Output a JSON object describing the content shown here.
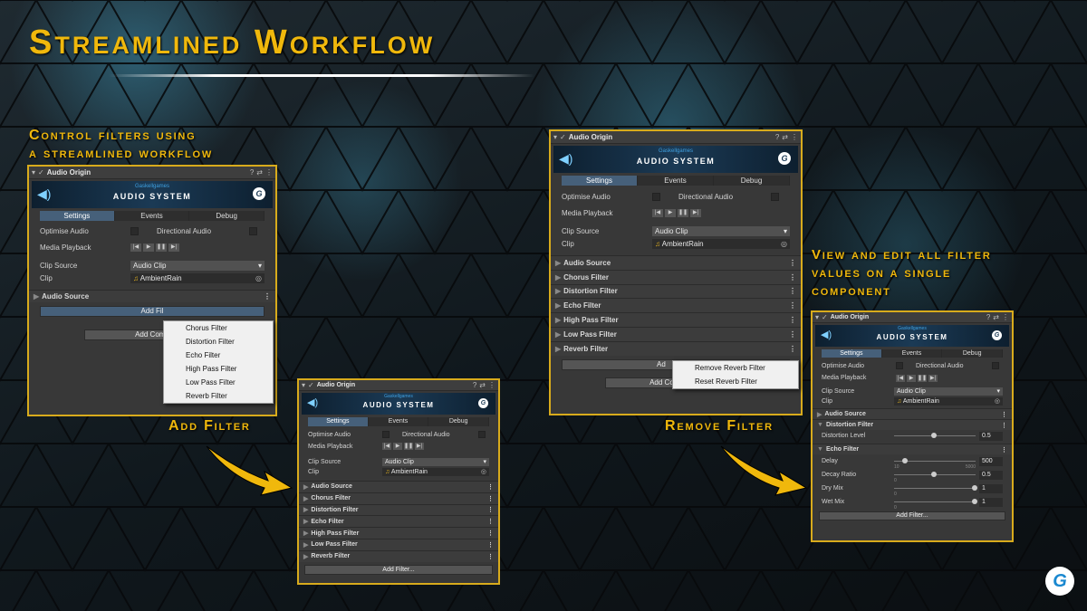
{
  "title": "Streamlined Workflow",
  "captions": {
    "control_l1": "Control filters using",
    "control_l2": "a streamlined workflow",
    "view_l1": "View and edit all filter",
    "view_l2": "values on a single",
    "view_l3": "component",
    "add_filter": "Add Filter",
    "remove_filter": "Remove Filter"
  },
  "component": {
    "name": "Audio Origin",
    "banner_sub": "Gaskellgames",
    "banner_title": "AUDIO SYSTEM",
    "tabs": [
      "Settings",
      "Events",
      "Debug"
    ],
    "optimise": "Optimise Audio",
    "directional": "Directional Audio",
    "media_playback": "Media Playback",
    "clip_source": "Clip Source",
    "clip_source_value": "Audio Clip",
    "clip": "Clip",
    "clip_value": "AmbientRain",
    "add_filter_btn": "Add Filter...",
    "add_component_btn": "Add Component",
    "add_component_trunc": "Add Comp",
    "add_trunc": "Add Fil",
    "add_short": "Ad"
  },
  "sections": [
    "Audio Source",
    "Chorus Filter",
    "Distortion Filter",
    "Echo Filter",
    "High Pass Filter",
    "Low Pass Filter",
    "Reverb Filter"
  ],
  "add_menu": [
    "Chorus Filter",
    "Distortion Filter",
    "Echo Filter",
    "High Pass Filter",
    "Low Pass Filter",
    "Reverb Filter"
  ],
  "remove_menu": [
    "Remove Reverb Filter",
    "Reset Reverb Filter"
  ],
  "detail": {
    "distortion_level": "Distortion Level",
    "distortion_value": "0.5",
    "delay": "Delay",
    "delay_value": "500",
    "delay_min": "10",
    "delay_max": "5000",
    "decay_ratio": "Decay Ratio",
    "decay_value": "0.5",
    "dry_mix": "Dry Mix",
    "dry_value": "1",
    "wet_mix": "Wet Mix",
    "wet_value": "1",
    "zero": "0"
  },
  "colors": {
    "accent": "#f0b80c",
    "border": "#d8ab1c",
    "panel": "#383838",
    "tab_active": "#46607a"
  },
  "icons": {
    "check": "✓",
    "help": "?",
    "preset": "⇄",
    "more": "⋮",
    "play": "▶",
    "pause": "❚❚",
    "step": "▶|",
    "note": "♫"
  }
}
